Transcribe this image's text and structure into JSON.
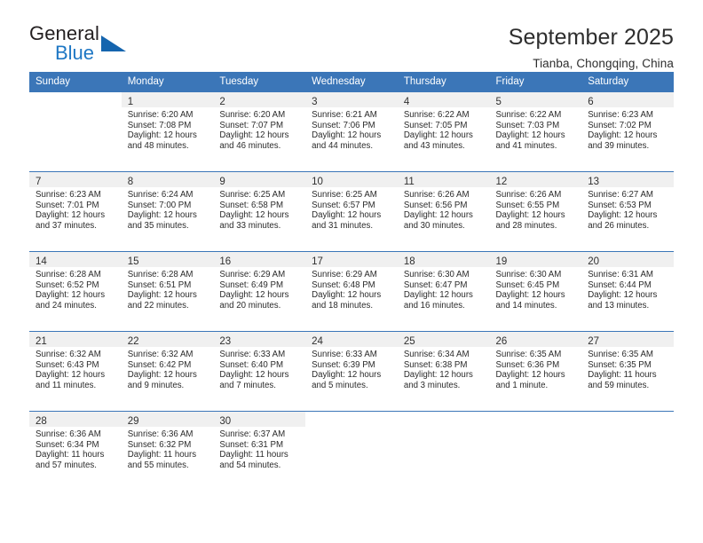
{
  "brand": {
    "word_one": "General",
    "word_two": "Blue",
    "triangle_icon": "triangle-icon",
    "accent_color": "#1565ae",
    "blue_text_color": "#1e77c4"
  },
  "header": {
    "title": "September 2025",
    "subtitle": "Tianba, Chongqing, China",
    "header_band_color": "#3b76b8",
    "daynum_band_color": "#f0f0f0"
  },
  "weekdays": [
    "Sunday",
    "Monday",
    "Tuesday",
    "Wednesday",
    "Thursday",
    "Friday",
    "Saturday"
  ],
  "weeks": [
    [
      {
        "day": "",
        "lines": []
      },
      {
        "day": "1",
        "lines": [
          "Sunrise: 6:20 AM",
          "Sunset: 7:08 PM",
          "Daylight: 12 hours",
          "and 48 minutes."
        ]
      },
      {
        "day": "2",
        "lines": [
          "Sunrise: 6:20 AM",
          "Sunset: 7:07 PM",
          "Daylight: 12 hours",
          "and 46 minutes."
        ]
      },
      {
        "day": "3",
        "lines": [
          "Sunrise: 6:21 AM",
          "Sunset: 7:06 PM",
          "Daylight: 12 hours",
          "and 44 minutes."
        ]
      },
      {
        "day": "4",
        "lines": [
          "Sunrise: 6:22 AM",
          "Sunset: 7:05 PM",
          "Daylight: 12 hours",
          "and 43 minutes."
        ]
      },
      {
        "day": "5",
        "lines": [
          "Sunrise: 6:22 AM",
          "Sunset: 7:03 PM",
          "Daylight: 12 hours",
          "and 41 minutes."
        ]
      },
      {
        "day": "6",
        "lines": [
          "Sunrise: 6:23 AM",
          "Sunset: 7:02 PM",
          "Daylight: 12 hours",
          "and 39 minutes."
        ]
      }
    ],
    [
      {
        "day": "7",
        "lines": [
          "Sunrise: 6:23 AM",
          "Sunset: 7:01 PM",
          "Daylight: 12 hours",
          "and 37 minutes."
        ]
      },
      {
        "day": "8",
        "lines": [
          "Sunrise: 6:24 AM",
          "Sunset: 7:00 PM",
          "Daylight: 12 hours",
          "and 35 minutes."
        ]
      },
      {
        "day": "9",
        "lines": [
          "Sunrise: 6:25 AM",
          "Sunset: 6:58 PM",
          "Daylight: 12 hours",
          "and 33 minutes."
        ]
      },
      {
        "day": "10",
        "lines": [
          "Sunrise: 6:25 AM",
          "Sunset: 6:57 PM",
          "Daylight: 12 hours",
          "and 31 minutes."
        ]
      },
      {
        "day": "11",
        "lines": [
          "Sunrise: 6:26 AM",
          "Sunset: 6:56 PM",
          "Daylight: 12 hours",
          "and 30 minutes."
        ]
      },
      {
        "day": "12",
        "lines": [
          "Sunrise: 6:26 AM",
          "Sunset: 6:55 PM",
          "Daylight: 12 hours",
          "and 28 minutes."
        ]
      },
      {
        "day": "13",
        "lines": [
          "Sunrise: 6:27 AM",
          "Sunset: 6:53 PM",
          "Daylight: 12 hours",
          "and 26 minutes."
        ]
      }
    ],
    [
      {
        "day": "14",
        "lines": [
          "Sunrise: 6:28 AM",
          "Sunset: 6:52 PM",
          "Daylight: 12 hours",
          "and 24 minutes."
        ]
      },
      {
        "day": "15",
        "lines": [
          "Sunrise: 6:28 AM",
          "Sunset: 6:51 PM",
          "Daylight: 12 hours",
          "and 22 minutes."
        ]
      },
      {
        "day": "16",
        "lines": [
          "Sunrise: 6:29 AM",
          "Sunset: 6:49 PM",
          "Daylight: 12 hours",
          "and 20 minutes."
        ]
      },
      {
        "day": "17",
        "lines": [
          "Sunrise: 6:29 AM",
          "Sunset: 6:48 PM",
          "Daylight: 12 hours",
          "and 18 minutes."
        ]
      },
      {
        "day": "18",
        "lines": [
          "Sunrise: 6:30 AM",
          "Sunset: 6:47 PM",
          "Daylight: 12 hours",
          "and 16 minutes."
        ]
      },
      {
        "day": "19",
        "lines": [
          "Sunrise: 6:30 AM",
          "Sunset: 6:45 PM",
          "Daylight: 12 hours",
          "and 14 minutes."
        ]
      },
      {
        "day": "20",
        "lines": [
          "Sunrise: 6:31 AM",
          "Sunset: 6:44 PM",
          "Daylight: 12 hours",
          "and 13 minutes."
        ]
      }
    ],
    [
      {
        "day": "21",
        "lines": [
          "Sunrise: 6:32 AM",
          "Sunset: 6:43 PM",
          "Daylight: 12 hours",
          "and 11 minutes."
        ]
      },
      {
        "day": "22",
        "lines": [
          "Sunrise: 6:32 AM",
          "Sunset: 6:42 PM",
          "Daylight: 12 hours",
          "and 9 minutes."
        ]
      },
      {
        "day": "23",
        "lines": [
          "Sunrise: 6:33 AM",
          "Sunset: 6:40 PM",
          "Daylight: 12 hours",
          "and 7 minutes."
        ]
      },
      {
        "day": "24",
        "lines": [
          "Sunrise: 6:33 AM",
          "Sunset: 6:39 PM",
          "Daylight: 12 hours",
          "and 5 minutes."
        ]
      },
      {
        "day": "25",
        "lines": [
          "Sunrise: 6:34 AM",
          "Sunset: 6:38 PM",
          "Daylight: 12 hours",
          "and 3 minutes."
        ]
      },
      {
        "day": "26",
        "lines": [
          "Sunrise: 6:35 AM",
          "Sunset: 6:36 PM",
          "Daylight: 12 hours",
          "and 1 minute."
        ]
      },
      {
        "day": "27",
        "lines": [
          "Sunrise: 6:35 AM",
          "Sunset: 6:35 PM",
          "Daylight: 11 hours",
          "and 59 minutes."
        ]
      }
    ],
    [
      {
        "day": "28",
        "lines": [
          "Sunrise: 6:36 AM",
          "Sunset: 6:34 PM",
          "Daylight: 11 hours",
          "and 57 minutes."
        ]
      },
      {
        "day": "29",
        "lines": [
          "Sunrise: 6:36 AM",
          "Sunset: 6:32 PM",
          "Daylight: 11 hours",
          "and 55 minutes."
        ]
      },
      {
        "day": "30",
        "lines": [
          "Sunrise: 6:37 AM",
          "Sunset: 6:31 PM",
          "Daylight: 11 hours",
          "and 54 minutes."
        ]
      },
      {
        "day": "",
        "lines": []
      },
      {
        "day": "",
        "lines": []
      },
      {
        "day": "",
        "lines": []
      },
      {
        "day": "",
        "lines": []
      }
    ]
  ]
}
